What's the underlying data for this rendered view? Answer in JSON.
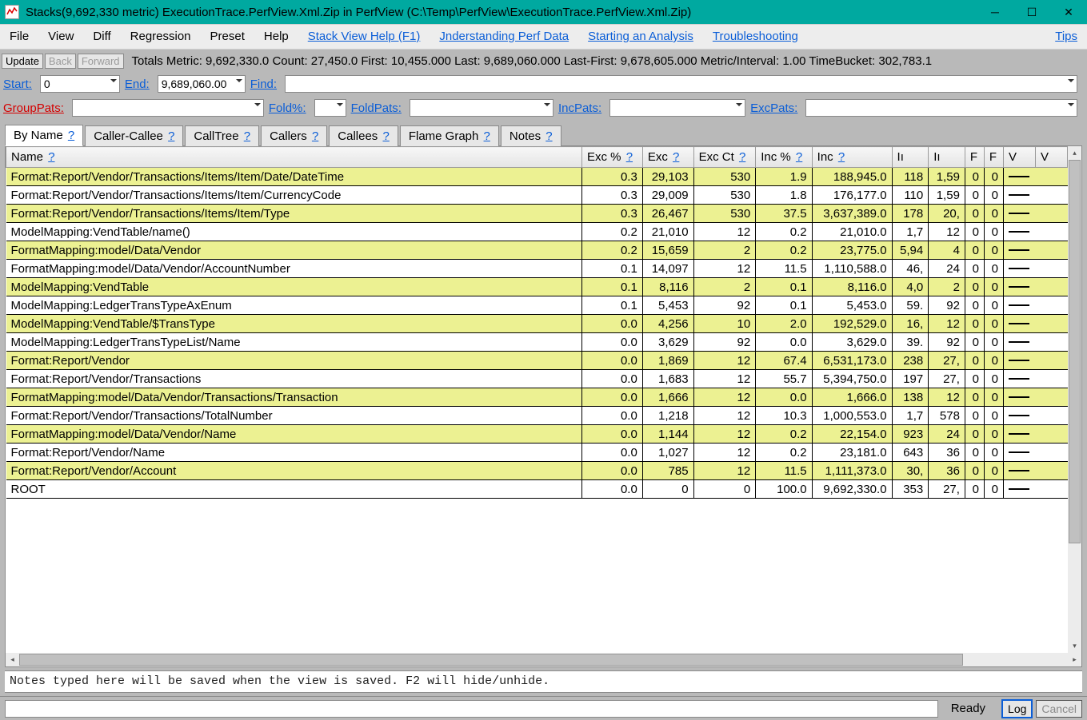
{
  "title": "Stacks(9,692,330 metric) ExecutionTrace.PerfView.Xml.Zip in PerfView (C:\\Temp\\PerfView\\ExecutionTrace.PerfView.Xml.Zip)",
  "menu": {
    "file": "File",
    "view": "View",
    "diff": "Diff",
    "regression": "Regression",
    "preset": "Preset",
    "help": "Help",
    "stack_view_help": "Stack View Help (F1)",
    "understanding": "Jnderstanding Perf Data",
    "starting_analysis": "Starting an Analysis",
    "troubleshooting": "Troubleshooting",
    "tips": "Tips"
  },
  "toolbar": {
    "update": "Update",
    "back": "Back",
    "forward": "Forward",
    "totals": "Totals Metric: 9,692,330.0   Count: 27,450.0   First: 10,455.000  Last: 9,689,060.000   Last-First: 9,678,605.000   Metric/Interval: 1.00   TimeBucket: 302,783.1"
  },
  "params": {
    "start_label": "Start:",
    "start_value": "0",
    "end_label": "End:",
    "end_value": "9,689,060.00",
    "find_label": "Find:",
    "find_value": "",
    "grouppats_label": "GroupPats:",
    "grouppats_value": "",
    "foldpct_label": "Fold%:",
    "foldpct_value": "",
    "foldpats_label": "FoldPats:",
    "foldpats_value": "",
    "incpats_label": "IncPats:",
    "incpats_value": "",
    "excpats_label": "ExcPats:",
    "excpats_value": ""
  },
  "tabs": {
    "by_name": "By Name",
    "caller_callee": "Caller-Callee",
    "calltree": "CallTree",
    "callers": "Callers",
    "callees": "Callees",
    "flame_graph": "Flame Graph",
    "notes": "Notes",
    "help_q": "?"
  },
  "columns": {
    "name": "Name",
    "exc_pct": "Exc %",
    "exc": "Exc",
    "exc_ct": "Exc Ct",
    "inc_pct": "Inc %",
    "inc": "Inc",
    "inc_small1": "Iı",
    "inc_small2": "Iı",
    "f1": "F",
    "f2": "F",
    "v1": "V",
    "v2": "V"
  },
  "rows": [
    {
      "name": "Format:Report/Vendor/Transactions/Items/Item/Date/DateTime",
      "exc_pct": "0.3",
      "exc": "29,103",
      "exc_ct": "530",
      "inc_pct": "1.9",
      "inc": "188,945.0",
      "c1": "118",
      "c2": "1,59",
      "f1": "0",
      "f2": "0"
    },
    {
      "name": "Format:Report/Vendor/Transactions/Items/Item/CurrencyCode",
      "exc_pct": "0.3",
      "exc": "29,009",
      "exc_ct": "530",
      "inc_pct": "1.8",
      "inc": "176,177.0",
      "c1": "110",
      "c2": "1,59",
      "f1": "0",
      "f2": "0"
    },
    {
      "name": "Format:Report/Vendor/Transactions/Items/Item/Type",
      "exc_pct": "0.3",
      "exc": "26,467",
      "exc_ct": "530",
      "inc_pct": "37.5",
      "inc": "3,637,389.0",
      "c1": "178",
      "c2": "20,",
      "f1": "0",
      "f2": "0"
    },
    {
      "name": "ModelMapping:VendTable/name()",
      "exc_pct": "0.2",
      "exc": "21,010",
      "exc_ct": "12",
      "inc_pct": "0.2",
      "inc": "21,010.0",
      "c1": "1,7",
      "c2": "12",
      "f1": "0",
      "f2": "0"
    },
    {
      "name": "FormatMapping:model/Data/Vendor",
      "exc_pct": "0.2",
      "exc": "15,659",
      "exc_ct": "2",
      "inc_pct": "0.2",
      "inc": "23,775.0",
      "c1": "5,94",
      "c2": "4",
      "f1": "0",
      "f2": "0"
    },
    {
      "name": "FormatMapping:model/Data/Vendor/AccountNumber",
      "exc_pct": "0.1",
      "exc": "14,097",
      "exc_ct": "12",
      "inc_pct": "11.5",
      "inc": "1,110,588.0",
      "c1": "46,",
      "c2": "24",
      "f1": "0",
      "f2": "0"
    },
    {
      "name": "ModelMapping:VendTable",
      "exc_pct": "0.1",
      "exc": "8,116",
      "exc_ct": "2",
      "inc_pct": "0.1",
      "inc": "8,116.0",
      "c1": "4,0",
      "c2": "2",
      "f1": "0",
      "f2": "0"
    },
    {
      "name": "ModelMapping:LedgerTransTypeAxEnum",
      "exc_pct": "0.1",
      "exc": "5,453",
      "exc_ct": "92",
      "inc_pct": "0.1",
      "inc": "5,453.0",
      "c1": "59.",
      "c2": "92",
      "f1": "0",
      "f2": "0"
    },
    {
      "name": "ModelMapping:VendTable/$TransType",
      "exc_pct": "0.0",
      "exc": "4,256",
      "exc_ct": "10",
      "inc_pct": "2.0",
      "inc": "192,529.0",
      "c1": "16,",
      "c2": "12",
      "f1": "0",
      "f2": "0"
    },
    {
      "name": "ModelMapping:LedgerTransTypeList/Name",
      "exc_pct": "0.0",
      "exc": "3,629",
      "exc_ct": "92",
      "inc_pct": "0.0",
      "inc": "3,629.0",
      "c1": "39.",
      "c2": "92",
      "f1": "0",
      "f2": "0"
    },
    {
      "name": "Format:Report/Vendor",
      "exc_pct": "0.0",
      "exc": "1,869",
      "exc_ct": "12",
      "inc_pct": "67.4",
      "inc": "6,531,173.0",
      "c1": "238",
      "c2": "27,",
      "f1": "0",
      "f2": "0"
    },
    {
      "name": "Format:Report/Vendor/Transactions",
      "exc_pct": "0.0",
      "exc": "1,683",
      "exc_ct": "12",
      "inc_pct": "55.7",
      "inc": "5,394,750.0",
      "c1": "197",
      "c2": "27,",
      "f1": "0",
      "f2": "0"
    },
    {
      "name": "FormatMapping:model/Data/Vendor/Transactions/Transaction",
      "exc_pct": "0.0",
      "exc": "1,666",
      "exc_ct": "12",
      "inc_pct": "0.0",
      "inc": "1,666.0",
      "c1": "138",
      "c2": "12",
      "f1": "0",
      "f2": "0"
    },
    {
      "name": "Format:Report/Vendor/Transactions/TotalNumber",
      "exc_pct": "0.0",
      "exc": "1,218",
      "exc_ct": "12",
      "inc_pct": "10.3",
      "inc": "1,000,553.0",
      "c1": "1,7",
      "c2": "578",
      "f1": "0",
      "f2": "0"
    },
    {
      "name": "FormatMapping:model/Data/Vendor/Name",
      "exc_pct": "0.0",
      "exc": "1,144",
      "exc_ct": "12",
      "inc_pct": "0.2",
      "inc": "22,154.0",
      "c1": "923",
      "c2": "24",
      "f1": "0",
      "f2": "0"
    },
    {
      "name": "Format:Report/Vendor/Name",
      "exc_pct": "0.0",
      "exc": "1,027",
      "exc_ct": "12",
      "inc_pct": "0.2",
      "inc": "23,181.0",
      "c1": "643",
      "c2": "36",
      "f1": "0",
      "f2": "0"
    },
    {
      "name": "Format:Report/Vendor/Account",
      "exc_pct": "0.0",
      "exc": "785",
      "exc_ct": "12",
      "inc_pct": "11.5",
      "inc": "1,111,373.0",
      "c1": "30,",
      "c2": "36",
      "f1": "0",
      "f2": "0"
    },
    {
      "name": "ROOT",
      "exc_pct": "0.0",
      "exc": "0",
      "exc_ct": "0",
      "inc_pct": "100.0",
      "inc": "9,692,330.0",
      "c1": "353",
      "c2": "27,",
      "f1": "0",
      "f2": "0"
    }
  ],
  "notes": "Notes typed here will be saved when the view is saved. F2 will hide/unhide.",
  "status": {
    "ready": "Ready",
    "log": "Log",
    "cancel": "Cancel"
  }
}
